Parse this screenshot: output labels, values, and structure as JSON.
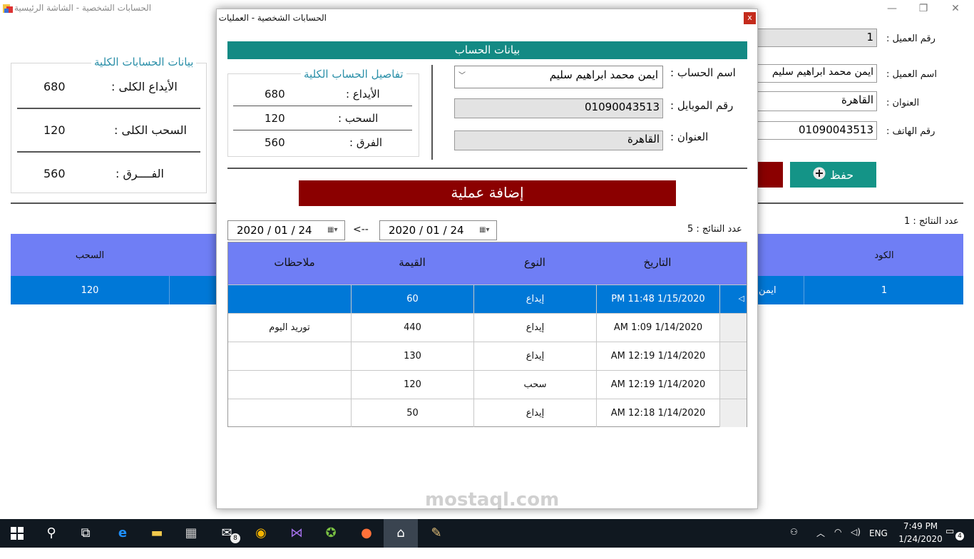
{
  "main_window": {
    "title": "الحسابات الشخصية - الشاشة الرئيسية",
    "controls": {
      "minimize": "—",
      "restore": "❐",
      "close": "✕"
    },
    "customer_form": {
      "id_label": "رقم العميل :",
      "id_value": "1",
      "name_label": "اسم العميل :",
      "name_value": "ايمن محمد ابراهيم سليم",
      "address_label": "العنوان :",
      "address_value": "القاهرة",
      "phone_label": "رقم الهاتف :",
      "phone_value": "01090043513"
    },
    "save_button": "حفظ",
    "totals": {
      "title": "بيانات الحسابات الكلية",
      "deposit_label": "الأيداع الكلى :",
      "deposit_value": "680",
      "withdraw_label": "السحب الكلى :",
      "withdraw_value": "120",
      "diff_label": "الفــــرق :",
      "diff_value": "560"
    },
    "results_count": "عدد النتائج : 1",
    "grid": {
      "headers": [
        "الكود",
        "السحب"
      ],
      "selected_row": {
        "code": "1",
        "name_fragment": "ايمن",
        "withdraw": "120"
      }
    }
  },
  "dialog": {
    "title": "الحسابات الشخصية - العمليات",
    "close_label": "x",
    "banner": "بيانات الحساب",
    "account_name_label": "اسم الحساب :",
    "account_name_value": "ايمن محمد ابراهيم سليم",
    "mobile_label": "رقم الموبايل :",
    "mobile_value": "01090043513",
    "address_label": "العنوان :",
    "address_value": "القاهرة",
    "summary": {
      "title": "تفاصيل الحساب الكلية",
      "deposit_label": "الأيداع :",
      "deposit_value": "680",
      "withdraw_label": "السحب :",
      "withdraw_value": "120",
      "diff_label": "الفرق :",
      "diff_value": "560"
    },
    "add_operation": "إضافة عملية",
    "date_from": "2020 / 01 / 24",
    "date_to": "2020 / 01 / 24",
    "date_arrow": "<--",
    "results_count": "عدد النتائج : 5",
    "grid": {
      "headers": {
        "date": "التاريخ",
        "type": "النوع",
        "amount": "القيمة",
        "notes": "ملاحظات"
      },
      "rows": [
        {
          "date": "PM 11:48 1/15/2020",
          "type": "إيداع",
          "amount": "60",
          "notes": ""
        },
        {
          "date": "AM 1:09 1/14/2020",
          "type": "إيداع",
          "amount": "440",
          "notes": "توريد اليوم"
        },
        {
          "date": "AM 12:19 1/14/2020",
          "type": "إيداع",
          "amount": "130",
          "notes": ""
        },
        {
          "date": "AM 12:19 1/14/2020",
          "type": "سحب",
          "amount": "120",
          "notes": ""
        },
        {
          "date": "AM 12:18 1/14/2020",
          "type": "إيداع",
          "amount": "50",
          "notes": ""
        }
      ]
    }
  },
  "taskbar": {
    "mail_badge": "8",
    "language": "ENG",
    "time": "7:49 PM",
    "date": "1/24/2020",
    "notifications": "4"
  },
  "watermark": "mostaql.com",
  "colors": {
    "teal": "#138a84",
    "dark_red": "#8b0000",
    "grid_header": "#6f7ef5",
    "selection": "#0078d7"
  }
}
